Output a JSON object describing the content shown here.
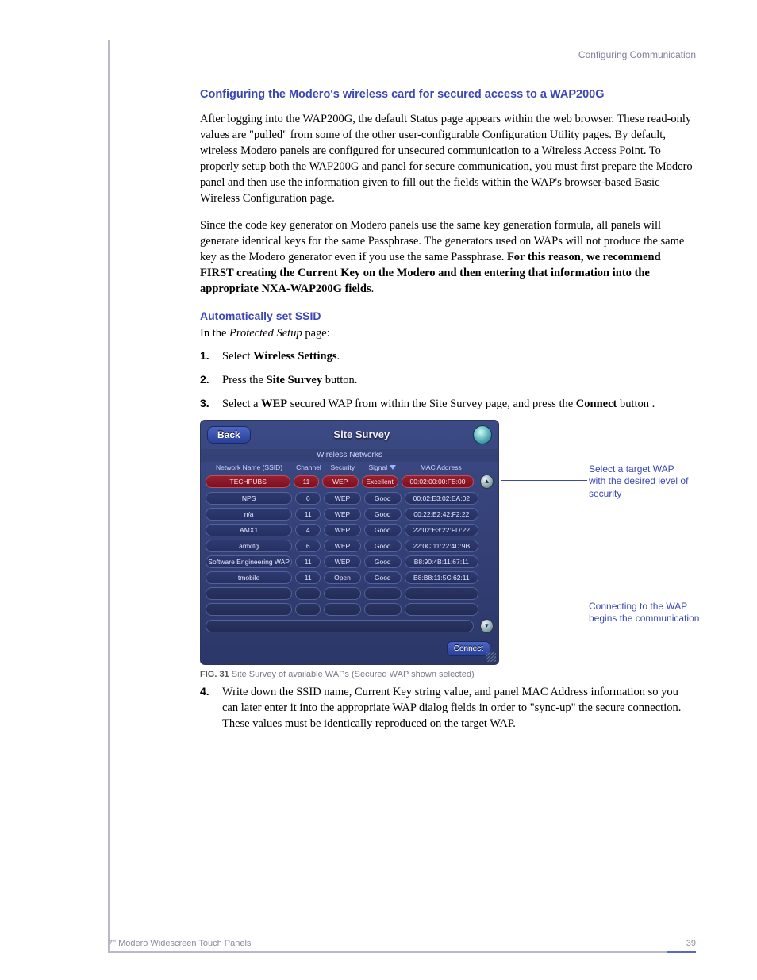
{
  "header": {
    "section": "Configuring Communication"
  },
  "h1": "Configuring the Modero's wireless card for secured access to a WAP200G",
  "p1": "After logging into the WAP200G, the default Status page appears within the web browser. These  read-only values are \"pulled\" from some of the other user-configurable Configuration Utility pages. By default, wireless Modero panels are configured for unsecured communication to a Wireless Access Point. To properly setup both the WAP200G and panel for secure communication, you must first prepare the Modero panel and then use the information given to fill out the fields within the WAP's browser-based Basic Wireless Configuration page.",
  "p2_lead": "Since the code key generator on Modero panels use the same key generation formula, all panels will generate identical keys for the same Passphrase. The generators used on WAPs will not produce the same key as the Modero generator even if you use the same Passphrase. ",
  "p2_bold": "For this reason, we recommend FIRST creating the Current Key on the Modero and then entering that information into the appropriate NXA-WAP200G fields",
  "p2_tail": ".",
  "h2": "Automatically set SSID",
  "intro_pre": "In the ",
  "intro_it": "Protected Setup",
  "intro_post": " page:",
  "steps": {
    "n1": "1.",
    "s1a": "Select ",
    "s1b": "Wireless Settings",
    "s1c": ".",
    "n2": "2.",
    "s2a": "Press the ",
    "s2b": "Site Survey",
    "s2c": " button.",
    "n3": "3.",
    "s3a": "Select a ",
    "s3b": "WEP",
    "s3c": " secured WAP from within the Site Survey page, and press the ",
    "s3d": "Connect",
    "s3e": " button   .",
    "n4": "4.",
    "s4": "Write down the SSID name, Current Key string value, and panel MAC Address information so you can later enter it into the appropriate WAP dialog fields in order to \"sync-up\" the secure connection. These values must be identically reproduced on the target WAP."
  },
  "panel": {
    "back": "Back",
    "title": "Site Survey",
    "subtitle": "Wireless Networks",
    "headers": {
      "ssid": "Network Name (SSID)",
      "ch": "Channel",
      "sec": "Security",
      "sig": "Signal",
      "mac": "MAC Address"
    },
    "rows": [
      {
        "ssid": "TECHPUBS",
        "ch": "11",
        "sec": "WEP",
        "sig": "Excellent",
        "mac": "00:02:00:00:FB:00",
        "sel": true
      },
      {
        "ssid": "NPS",
        "ch": "6",
        "sec": "WEP",
        "sig": "Good",
        "mac": "00:02:E3:02:EA:02"
      },
      {
        "ssid": "n/a",
        "ch": "11",
        "sec": "WEP",
        "sig": "Good",
        "mac": "00:22:E2:42:F2:22"
      },
      {
        "ssid": "AMX1",
        "ch": "4",
        "sec": "WEP",
        "sig": "Good",
        "mac": "22:02:E3:22:FD:22"
      },
      {
        "ssid": "amxitg",
        "ch": "6",
        "sec": "WEP",
        "sig": "Good",
        "mac": "22:0C:11:22:4D:9B"
      },
      {
        "ssid": "Software Engineering WAP",
        "ch": "11",
        "sec": "WEP",
        "sig": "Good",
        "mac": "B8:90:4B:11:67:11"
      },
      {
        "ssid": "tmobile",
        "ch": "11",
        "sec": "Open",
        "sig": "Good",
        "mac": "B8:B8:11:5C:62:11"
      }
    ],
    "connect": "Connect"
  },
  "callouts": {
    "top": "Select a target WAP with the desired level of security",
    "bot": "Connecting to the WAP begins the communication"
  },
  "figcap_b": "FIG. 31",
  "figcap_t": "  Site Survey of available WAPs (Secured WAP shown selected)",
  "footer": {
    "left": "7\" Modero Widescreen Touch Panels",
    "right": "39"
  }
}
